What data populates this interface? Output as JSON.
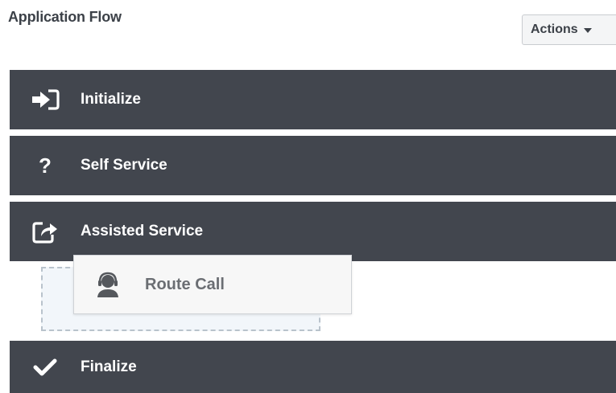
{
  "header": {
    "title": "Application Flow",
    "actions_label": "Actions"
  },
  "phases": [
    {
      "label": "Initialize",
      "icon": "sign-in-icon"
    },
    {
      "label": "Self Service",
      "icon": "question-icon"
    },
    {
      "label": "Assisted Service",
      "icon": "share-square-icon"
    },
    {
      "label": "Finalize",
      "icon": "checkmark-icon"
    }
  ],
  "dragged_block": {
    "label": "Route Call",
    "icon": "headset-agent-icon"
  },
  "colors": {
    "phase_bar": "#42464e",
    "phase_text": "#ffffff",
    "title_text": "#3c4148",
    "dropzone_border": "#b9c3cc",
    "dropzone_fill": "#f2f6fa",
    "block_text": "#6b6e73"
  }
}
